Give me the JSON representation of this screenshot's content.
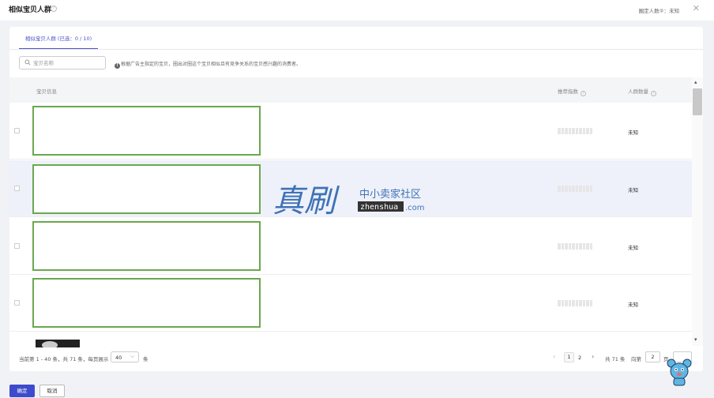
{
  "dialog": {
    "title": "相似宝贝人群",
    "count_label": "圈定人数②：未知",
    "tab_label": "相似宝贝人群 (已选：0 / 10)"
  },
  "search": {
    "placeholder": "宝贝名称",
    "info_text": "根据广告主指定的宝贝，圈出对圈这个宝贝相似且有竞争关系的宝贝感兴趣的消费者。"
  },
  "table": {
    "headers": {
      "product": "宝贝信息",
      "score": "推荐指数",
      "crowd": "人群数量"
    },
    "rows": [
      {
        "crowd": "未知",
        "highlighted": false
      },
      {
        "crowd": "未知",
        "highlighted": true
      },
      {
        "crowd": "未知",
        "highlighted": false
      },
      {
        "crowd": "未知",
        "highlighted": false
      }
    ]
  },
  "pagination": {
    "summary": "当前第 1 - 40 条，共 71 条，每页展示",
    "page_size": "40",
    "page_size_unit": "条",
    "pages": [
      "1",
      "2"
    ],
    "current_page": "1",
    "total": "共 71 条",
    "goto_label": "向第",
    "goto_value": "2",
    "page_suffix": "页"
  },
  "footer": {
    "confirm": "确定",
    "cancel": "取消"
  },
  "watermark": {
    "main": "真刷",
    "sub": "中小卖家社区",
    "domain_box": "zhenshua",
    "domain_suffix": ".com"
  },
  "colors": {
    "accent": "#4a55c8",
    "confirm_button": "#3e4bcc",
    "product_border": "#6aa84f",
    "row_highlight": "#eef1fa",
    "watermark_blue": "#3f72b5"
  }
}
